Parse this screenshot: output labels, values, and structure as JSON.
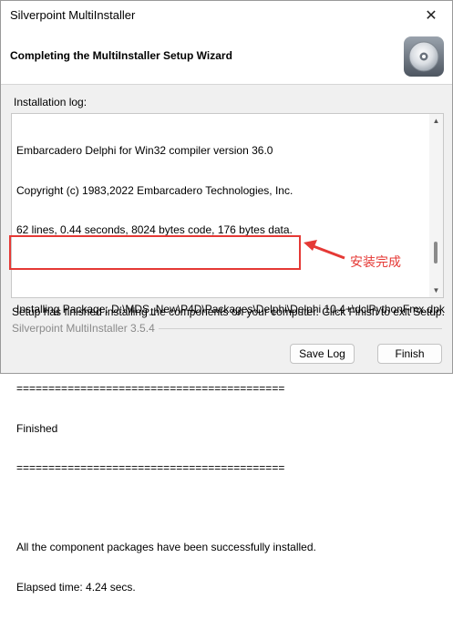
{
  "window": {
    "title": "Silverpoint MultiInstaller",
    "close_glyph": "✕"
  },
  "header": {
    "title": "Completing the MultiInstaller Setup Wizard",
    "logo_icon": "cd-disc-icon"
  },
  "log": {
    "label": "Installation log:",
    "lines": [
      "Embarcadero Delphi for Win32 compiler version 36.0",
      "Copyright (c) 1983,2022 Embarcadero Technologies, Inc.",
      "62 lines, 0.44 seconds, 8024 bytes code, 176 bytes data.",
      "",
      "Installing Package: D:\\MDS_New\\P4D\\Packages\\Delphi\\Delphi 10.4+\\dclPythonFmx.dpk",
      "",
      "==========================================",
      "Finished",
      "==========================================",
      "",
      "All the component packages have been successfully installed.",
      "Elapsed time: 4.24 secs."
    ]
  },
  "annotation": {
    "text": "安装完成",
    "color": "#e53935"
  },
  "footer": {
    "status": "Setup has finished installing the components on your computer. Click Finish to exit Setup.",
    "version": "Silverpoint MultiInstaller 3.5.4"
  },
  "buttons": {
    "save_log": "Save Log",
    "finish": "Finish"
  }
}
